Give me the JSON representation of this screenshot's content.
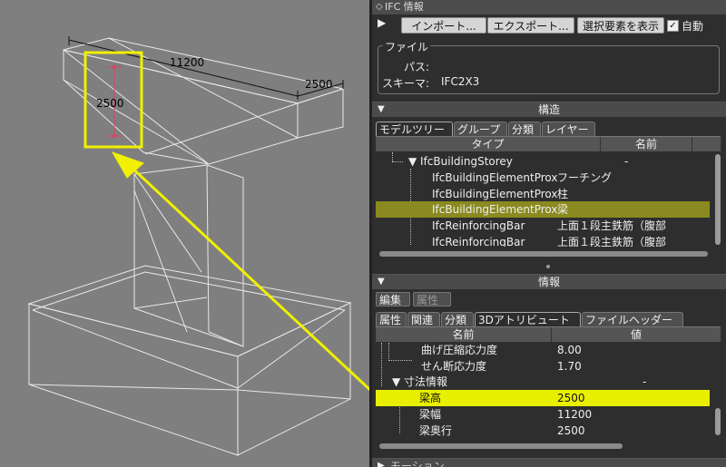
{
  "viewport": {
    "dim_length": "11200",
    "dim_width": "2500",
    "dim_height": "2500",
    "highlight_color": "#f0f000",
    "arrow_color": "#f0f000"
  },
  "panel": {
    "title": "IFC 情報",
    "toolbar": {
      "play_icon": "▶",
      "import_label": "インポート...",
      "export_label": "エクスポート...",
      "show_selected_label": "選択要素を表示",
      "auto_checkbox_mark": "✓",
      "auto_label": "自動"
    },
    "file_group": {
      "legend": "ファイル",
      "path_label": "パス:",
      "path_value": "",
      "schema_label": "スキーマ:",
      "schema_value": "IFC2X3"
    },
    "structure": {
      "header": "構造",
      "tabs": [
        "モデルツリー",
        "グループ",
        "分類",
        "レイヤー"
      ],
      "col_type": "タイプ",
      "col_name": "名前",
      "rows": [
        {
          "type": "IfcBuildingStorey",
          "name": "-"
        },
        {
          "type": "IfcBuildingElementProx",
          "name": "フーチング"
        },
        {
          "type": "IfcBuildingElementProx",
          "name": "柱"
        },
        {
          "type": "IfcBuildingElementProx",
          "name": "梁"
        },
        {
          "type": "IfcReinforcingBar",
          "name": "上面１段主鉄筋（腹部"
        },
        {
          "type": "IfcReinforcingBar",
          "name": "上面１段主鉄筋（腹部"
        }
      ]
    },
    "info": {
      "header": "情報",
      "edit_label": "編集",
      "attr_label": "属性",
      "tabs": [
        "属性",
        "関連",
        "分類",
        "3Dアトリビュート",
        "ファイルヘッダー"
      ],
      "col_name": "名前",
      "col_value": "値",
      "rows": [
        {
          "name": "曲げ圧縮応力度",
          "value": "8.00"
        },
        {
          "name": "せん断応力度",
          "value": "1.70"
        },
        {
          "name": "寸法情報",
          "value": "-"
        },
        {
          "name": "梁高",
          "value": "2500"
        },
        {
          "name": "梁幅",
          "value": "11200"
        },
        {
          "name": "梁奥行",
          "value": "2500"
        }
      ]
    },
    "bottom_header": "モーション"
  }
}
